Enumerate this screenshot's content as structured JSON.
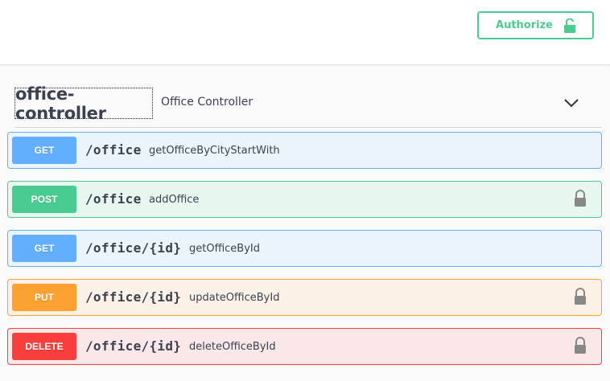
{
  "header": {
    "authorize_label": "Authorize",
    "authorize_color": "#49cc90"
  },
  "tag": {
    "name": "office-controller",
    "description": "Office Controller"
  },
  "operations": [
    {
      "method": "GET",
      "path": "/office",
      "summary": "getOfficeByCityStartWith",
      "locked": false,
      "color": "#61affe"
    },
    {
      "method": "POST",
      "path": "/office",
      "summary": "addOffice",
      "locked": true,
      "color": "#49cc90"
    },
    {
      "method": "GET",
      "path": "/office/{id}",
      "summary": "getOfficeById",
      "locked": false,
      "color": "#61affe"
    },
    {
      "method": "PUT",
      "path": "/office/{id}",
      "summary": "updateOfficeById",
      "locked": true,
      "color": "#fca130"
    },
    {
      "method": "DELETE",
      "path": "/office/{id}",
      "summary": "deleteOfficeById",
      "locked": true,
      "color": "#f93e3e"
    }
  ]
}
